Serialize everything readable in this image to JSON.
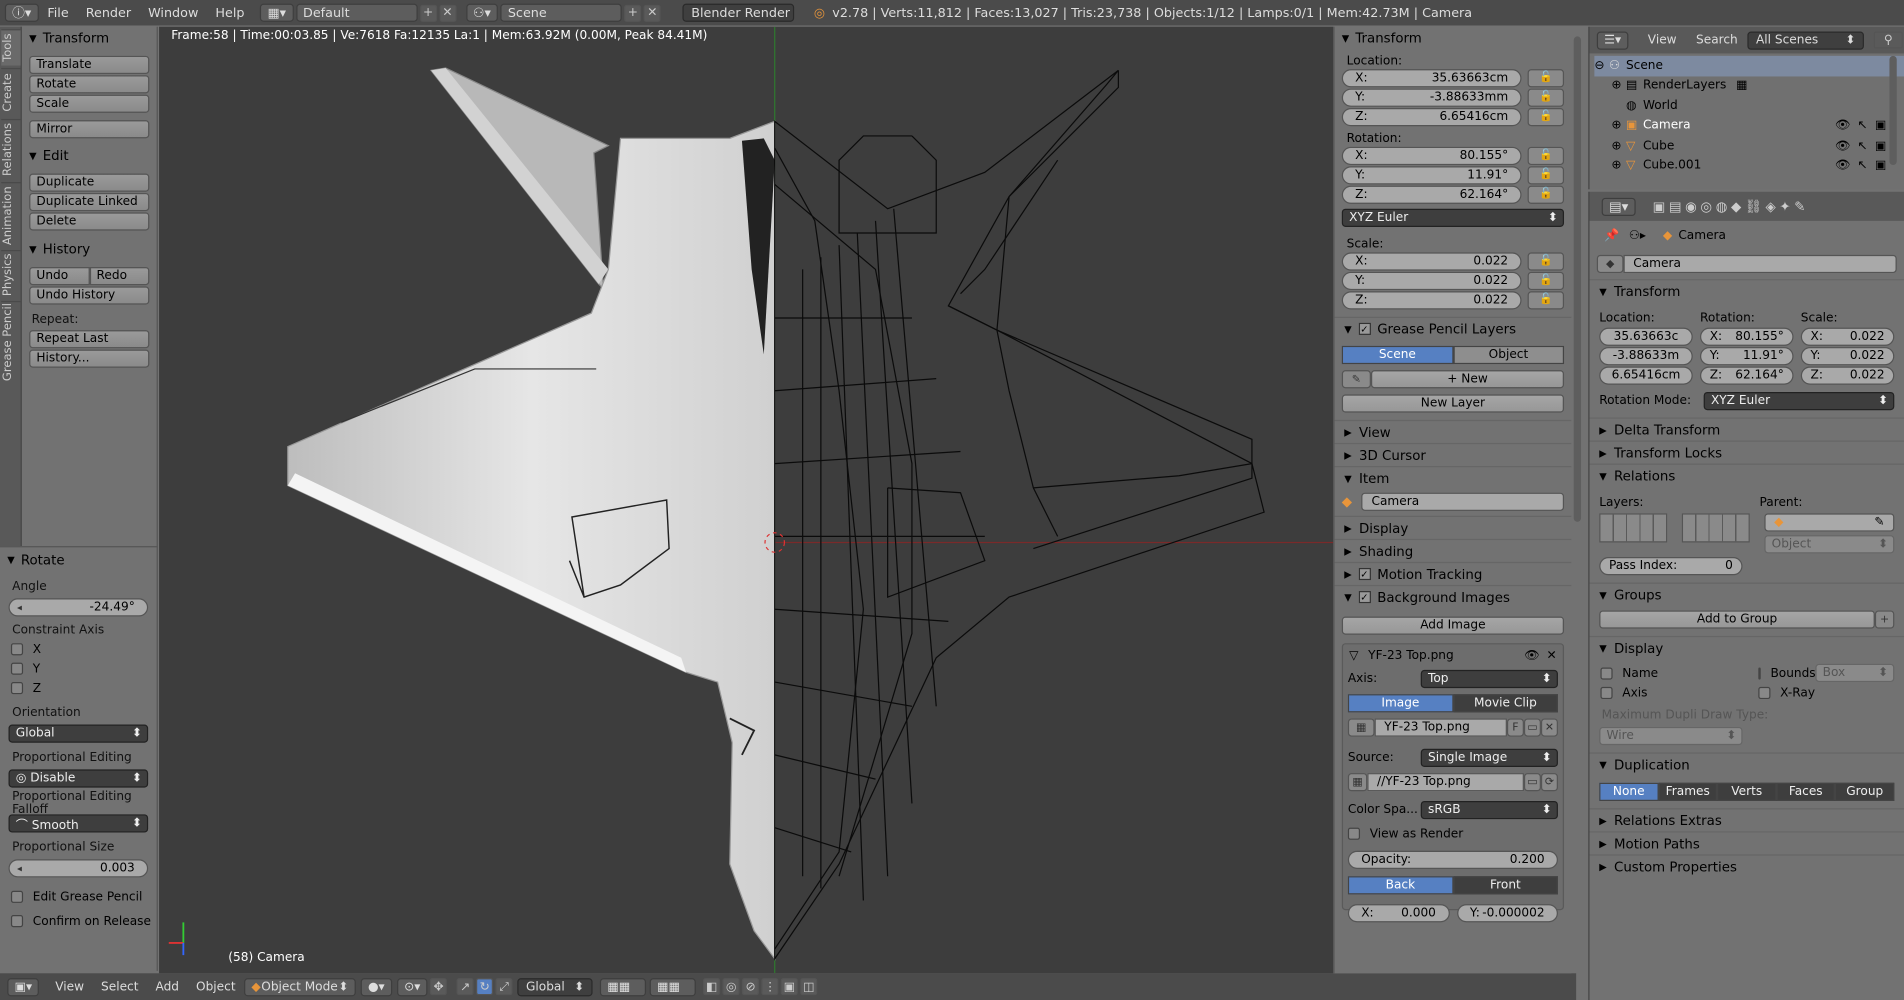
{
  "topbar": {
    "menus": [
      "File",
      "Render",
      "Window",
      "Help"
    ],
    "layout": "Default",
    "scene": "Scene",
    "engine": "Blender Render",
    "stats": "v2.78 | Verts:11,812 | Faces:13,027 | Tris:23,738 | Objects:1/12 | Lamps:0/1 | Mem:42.73M | Camera"
  },
  "tabs": [
    "Tools",
    "Create",
    "Relations",
    "Animation",
    "Physics",
    "Grease Pencil"
  ],
  "shelf": {
    "transform_title": "Transform",
    "translate": "Translate",
    "rotate": "Rotate",
    "scale": "Scale",
    "mirror": "Mirror",
    "edit_title": "Edit",
    "duplicate": "Duplicate",
    "duplicate_linked": "Duplicate Linked",
    "delete": "Delete",
    "history_title": "History",
    "undo": "Undo",
    "redo": "Redo",
    "undo_history": "Undo History",
    "repeat_label": "Repeat:",
    "repeat_last": "Repeat Last",
    "history_btn": "History..."
  },
  "operator": {
    "title": "Rotate",
    "angle_label": "Angle",
    "angle": "-24.49°",
    "constraint_label": "Constraint Axis",
    "x": "X",
    "y": "Y",
    "z": "Z",
    "orientation_label": "Orientation",
    "orientation": "Global",
    "prop_edit_label": "Proportional Editing",
    "prop_edit": "Disable",
    "falloff_label": "Proportional Editing Falloff",
    "falloff": "Smooth",
    "prop_size_label": "Proportional Size",
    "prop_size": "0.003",
    "edit_gp": "Edit Grease Pencil",
    "confirm": "Confirm on Release"
  },
  "viewport": {
    "header": "Frame:58 | Time:00:03.85 | Ve:7618 Fa:12135 La:1 | Mem:63.92M (0.00M, Peak 84.41M)",
    "camera": "(58) Camera"
  },
  "botbar": {
    "view": "View",
    "select": "Select",
    "add": "Add",
    "object": "Object",
    "mode": "Object Mode",
    "orientation": "Global"
  },
  "npanel": {
    "transform": "Transform",
    "location": "Location:",
    "lx": "35.63663cm",
    "ly": "-3.88633mm",
    "lz": "6.65416cm",
    "rotation": "Rotation:",
    "rx": "80.155°",
    "ry": "11.91°",
    "rz": "62.164°",
    "euler": "XYZ Euler",
    "scale": "Scale:",
    "sx": "0.022",
    "sy": "0.022",
    "sz": "0.022",
    "gp_layers": "Grease Pencil Layers",
    "scene": "Scene",
    "object": "Object",
    "new": "New",
    "new_layer": "New Layer",
    "view": "View",
    "cursor": "3D Cursor",
    "item": "Item",
    "item_name": "Camera",
    "display": "Display",
    "shading": "Shading",
    "motion": "Motion Tracking",
    "bg_images": "Background Images",
    "add_image": "Add Image",
    "img_name": "YF-23 Top.png",
    "axis_label": "Axis:",
    "axis": "Top",
    "image": "Image",
    "movie": "Movie Clip",
    "img_file": "YF-23 Top.png",
    "f": "F",
    "source_label": "Source:",
    "source": "Single Image",
    "path": "//YF-23 Top.png",
    "colorspace_label": "Color Spa...",
    "colorspace": "sRGB",
    "view_render": "View as Render",
    "opacity_label": "Opacity:",
    "opacity": "0.200",
    "back": "Back",
    "front": "Front",
    "ox": "0.000",
    "oy": "-0.000002",
    "x": "X:",
    "y": "Y:",
    "z": "Z:"
  },
  "outliner": {
    "view": "View",
    "search": "Search",
    "scenes": "All Scenes",
    "items": [
      "Scene",
      "RenderLayers",
      "World",
      "Camera",
      "Cube",
      "Cube.001"
    ]
  },
  "props": {
    "object_label": "Camera",
    "name": "Camera",
    "transform": "Transform",
    "location": "Location:",
    "rotation": "Rotation:",
    "scale": "Scale:",
    "lx": "35.63663c",
    "ly": "-3.88633m",
    "lz": "6.65416cm",
    "rx": "80.155°",
    "ry": "11.91°",
    "rz": "62.164°",
    "sx": "0.022",
    "sy": "0.022",
    "sz": "0.022",
    "rot_mode_label": "Rotation Mode:",
    "rot_mode": "XYZ Euler",
    "delta": "Delta Transform",
    "locks": "Transform Locks",
    "relations": "Relations",
    "layers": "Layers:",
    "parent": "Parent:",
    "parent_type": "Object",
    "pass_index_label": "Pass Index:",
    "pass_index": "0",
    "groups": "Groups",
    "add_group": "Add to Group",
    "display": "Display",
    "name_chk": "Name",
    "axis_chk": "Axis",
    "bounds": "Bounds",
    "box": "Box",
    "xray": "X-Ray",
    "max_dupli": "Maximum Dupli Draw Type:",
    "wire": "Wire",
    "duplication": "Duplication",
    "none": "None",
    "frames": "Frames",
    "verts": "Verts",
    "faces": "Faces",
    "group": "Group",
    "rel_extras": "Relations Extras",
    "motion_paths": "Motion Paths",
    "custom_props": "Custom Properties",
    "x": "X:",
    "y": "Y:",
    "z": "Z:"
  }
}
